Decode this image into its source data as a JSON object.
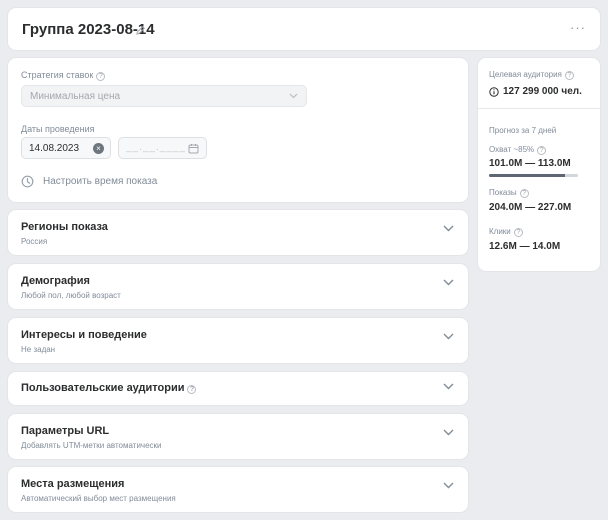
{
  "header": {
    "title": "Группа 2023-08-14",
    "more_label": "···"
  },
  "settings": {
    "bid_strategy_label": "Стратегия ставок",
    "bid_strategy_value": "Минимальная цена",
    "dates_label": "Даты проведения",
    "start_date": "14.08.2023",
    "end_date_placeholder": "__.__.____",
    "show_time_label": "Настроить время показа"
  },
  "sections": [
    {
      "title": "Регионы показа",
      "subtitle": "Россия"
    },
    {
      "title": "Демография",
      "subtitle": "Любой пол, любой возраст"
    },
    {
      "title": "Интересы и поведение",
      "subtitle": "Не задан"
    },
    {
      "title": "Пользовательские аудитории",
      "subtitle": ""
    },
    {
      "title": "Параметры URL",
      "subtitle": "Добавлять UTM-метки автоматически"
    },
    {
      "title": "Места размещения",
      "subtitle": "Автоматический выбор мест размещения"
    }
  ],
  "audience": {
    "target_label": "Целевая аудитория",
    "target_value": "127 299 000 чел.",
    "forecast_label": "Прогноз за 7 дней",
    "reach_label": "Охват ~85%",
    "reach_value": "101.0M — 113.0M",
    "reach_fraction": 0.85,
    "impressions_label": "Показы",
    "impressions_value": "204.0M — 227.0M",
    "clicks_label": "Клики",
    "clicks_value": "12.6M — 14.0M"
  }
}
